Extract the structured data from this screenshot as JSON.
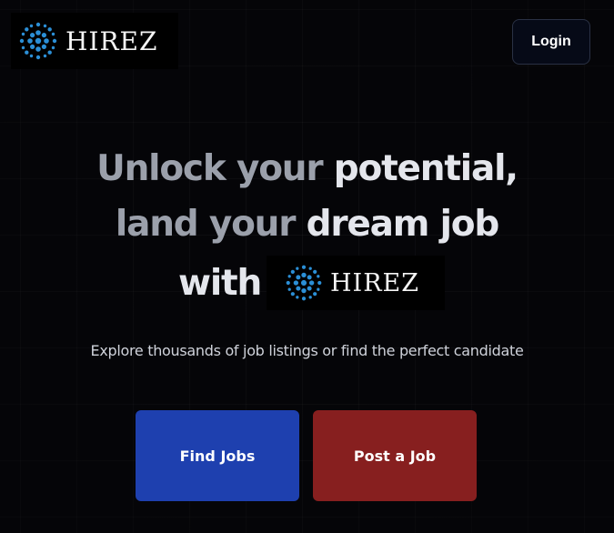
{
  "brand": {
    "name": "HIREZ",
    "logo_color": "#2b8fd6"
  },
  "header": {
    "login_label": "Login"
  },
  "hero": {
    "line1_muted": "Unlock your",
    "line1_bright": " potential,",
    "line2_muted": "land your",
    "line2_bright": " dream job",
    "with_word": "with",
    "subtitle": "Explore thousands of job listings or find the perfect candidate"
  },
  "actions": {
    "find_jobs_label": "Find Jobs",
    "post_job_label": "Post a Job",
    "find_jobs_color": "#1e40af",
    "post_job_color": "#871f1f"
  }
}
